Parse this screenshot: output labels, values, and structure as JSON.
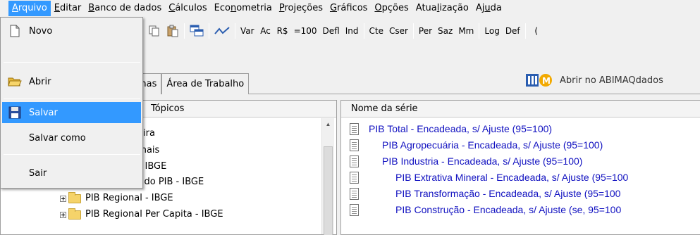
{
  "menubar": {
    "items": [
      {
        "pre": "",
        "u": "A",
        "post": "rquivo"
      },
      {
        "pre": "",
        "u": "E",
        "post": "ditar"
      },
      {
        "pre": "",
        "u": "B",
        "post": "anco de dados"
      },
      {
        "pre": "",
        "u": "C",
        "post": "álculos"
      },
      {
        "pre": "Eco",
        "u": "n",
        "post": "ometria"
      },
      {
        "pre": "",
        "u": "P",
        "post": "rojeções"
      },
      {
        "pre": "",
        "u": "G",
        "post": "ráficos"
      },
      {
        "pre": "",
        "u": "O",
        "post": "pções"
      },
      {
        "pre": "Atua",
        "u": "l",
        "post": "ização"
      },
      {
        "pre": "Aj",
        "u": "u",
        "post": "da"
      }
    ]
  },
  "toolbar": {
    "text_buttons": [
      "Var",
      "Ac",
      "R$",
      "=100",
      "Defl",
      "Ind",
      "Cte",
      "Cser",
      "Per",
      "Saz",
      "Mm",
      "Log",
      "Def",
      "("
    ]
  },
  "tabs": {
    "planilhas": "anilhas",
    "area": "Área de Trabalho"
  },
  "abrir_link": "Abrir no ABIMAQdados",
  "left_panel": {
    "header": "Tópicos",
    "rows": [
      "sileira",
      "cionais",
      "al - IBGE",
      "Composição do PIB - IBGE",
      "PIB Regional - IBGE",
      "PIB Regional Per Capita - IBGE"
    ]
  },
  "right_panel": {
    "header": "Nome da série",
    "series": [
      "PIB Total - Encadeada, s/ Ajuste (95=100)",
      "PIB Agropecuária - Encadeada, s/ Ajuste (95=100)",
      "PIB Industria - Encadeada, s/ Ajuste (95=100)",
      "PIB Extrativa Mineral - Encadeada, s/ Ajuste (95=100",
      "PIB Transformação - Encadeada, s/ Ajuste (95=100",
      "PIB Construção - Encadeada, s/ Ajuste (se, 95=100"
    ]
  },
  "dropdown": {
    "novo": "Novo",
    "abrir": "Abrir",
    "salvar": "Salvar",
    "salvar_como": "Salvar como",
    "sair": "Sair"
  },
  "colors": {
    "selection": "#3399ff",
    "series_text": "#1010c0"
  }
}
